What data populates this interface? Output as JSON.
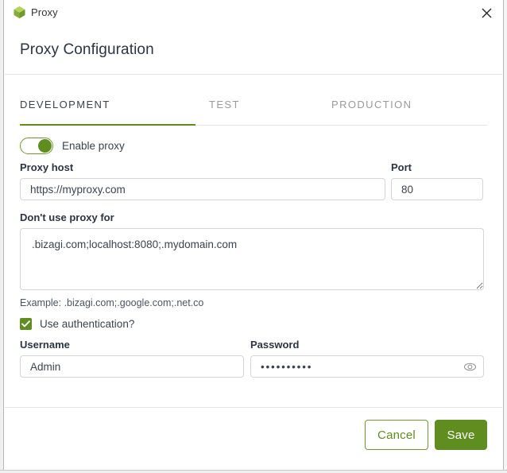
{
  "window": {
    "title": "Proxy",
    "icon": "cube-icon",
    "close_icon": "close-icon"
  },
  "dialog": {
    "heading": "Proxy Configuration"
  },
  "tabs": [
    {
      "label": "DEVELOPMENT",
      "active": true
    },
    {
      "label": "TEST",
      "active": false
    },
    {
      "label": "PRODUCTION",
      "active": false
    }
  ],
  "form": {
    "enable_proxy": {
      "label": "Enable proxy",
      "state": "on"
    },
    "proxy_host": {
      "label": "Proxy host",
      "value": "https://myproxy.com",
      "placeholder": ""
    },
    "port": {
      "label": "Port",
      "value": "80",
      "placeholder": ""
    },
    "no_proxy": {
      "label": "Don't use proxy for",
      "value": ".bizagi.com;localhost:8080;.mydomain.com",
      "placeholder": ""
    },
    "example": "Example: .bizagi.com;.google.com;.net.co",
    "use_authentication": {
      "label": "Use authentication?",
      "checked": true
    },
    "username": {
      "label": "Username",
      "value": "Admin",
      "placeholder": ""
    },
    "password": {
      "label": "Password",
      "value": "••••••••••",
      "placeholder": "",
      "reveal_icon": "eye-icon"
    }
  },
  "footer": {
    "cancel_label": "Cancel",
    "save_label": "Save"
  },
  "colors": {
    "accent_green": "#5f8d1f",
    "border_green": "#6d9b2a",
    "text_dark": "#2b3442",
    "text_muted": "#9a9a9a",
    "border_grey": "#d5d5d5"
  }
}
